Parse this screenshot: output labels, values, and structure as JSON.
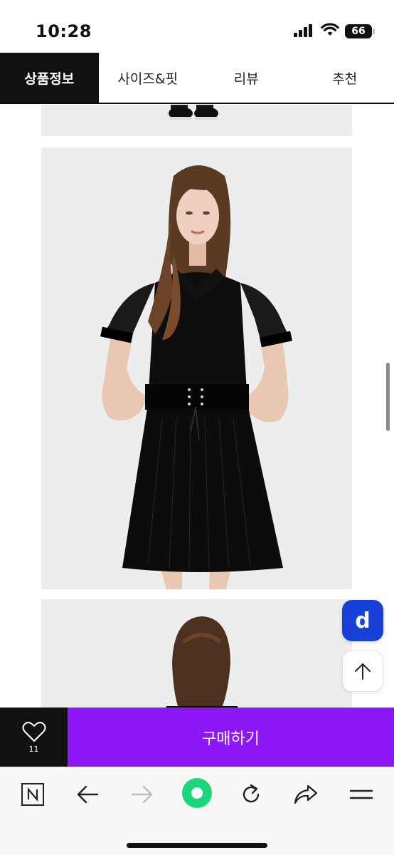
{
  "status": {
    "time": "10:28",
    "battery": "66"
  },
  "tabs": [
    {
      "label": "상품정보",
      "active": true
    },
    {
      "label": "사이즈&핏",
      "active": false
    },
    {
      "label": "리뷰",
      "active": false
    },
    {
      "label": "추천",
      "active": false
    }
  ],
  "floating": {
    "brand_badge": "d",
    "scroll_top_icon": "arrow-up-icon"
  },
  "purchase": {
    "like_count": "11",
    "buy_label": "구매하기"
  },
  "browser": {
    "icons": [
      "naver-n-icon",
      "back-arrow-icon",
      "forward-arrow-icon",
      "green-dot-icon",
      "refresh-icon",
      "share-icon",
      "menu-icon"
    ]
  },
  "colors": {
    "tab_active_bg": "#111111",
    "buy_button": "#8d17f7",
    "brand_badge": "#1740d8",
    "green_dot": "#19d77a",
    "photo_bg": "#eceeed"
  }
}
